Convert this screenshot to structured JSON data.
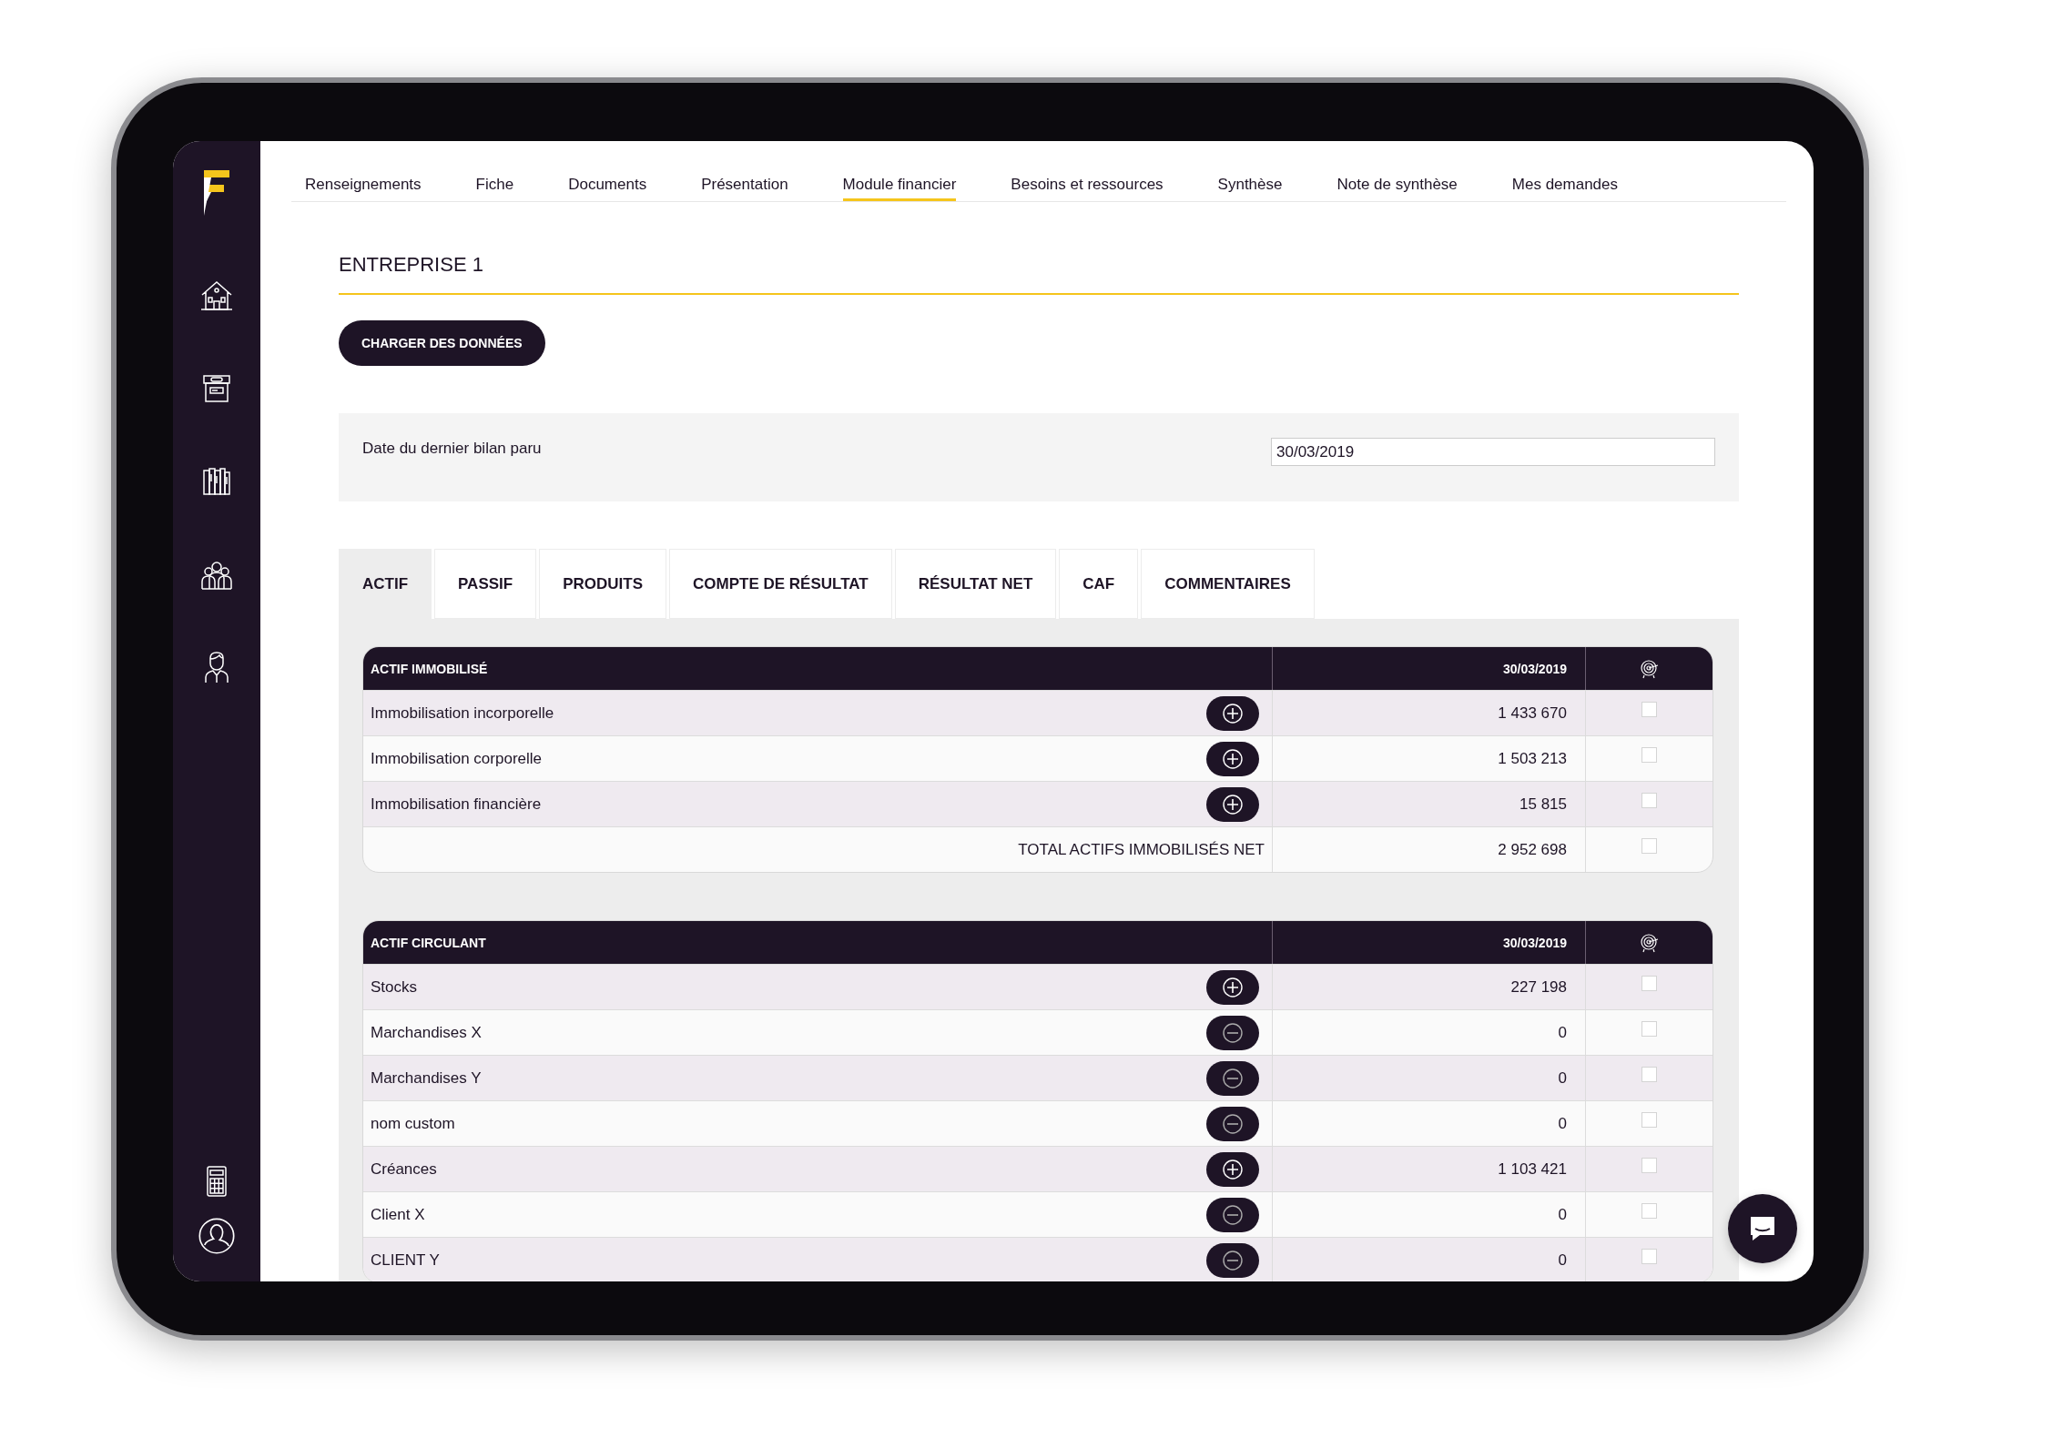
{
  "nav": {
    "items": [
      {
        "label": "Renseignements",
        "selected": false
      },
      {
        "label": "Fiche",
        "selected": false
      },
      {
        "label": "Documents",
        "selected": false
      },
      {
        "label": "Présentation",
        "selected": false
      },
      {
        "label": "Module financier",
        "selected": true
      },
      {
        "label": "Besoins et ressources",
        "selected": false
      },
      {
        "label": "Synthèse",
        "selected": false
      },
      {
        "label": "Note de synthèse",
        "selected": false
      },
      {
        "label": "Mes demandes",
        "selected": false
      }
    ]
  },
  "title": "ENTREPRISE 1",
  "load_button": "CHARGER DES DONNÉES",
  "date_field": {
    "label": "Date du dernier bilan paru",
    "value": "30/03/2019"
  },
  "tabs": [
    {
      "label": "ACTIF",
      "selected": true
    },
    {
      "label": "PASSIF",
      "selected": false
    },
    {
      "label": "PRODUITS",
      "selected": false
    },
    {
      "label": "COMPTE DE RÉSULTAT",
      "selected": false
    },
    {
      "label": "RÉSULTAT NET",
      "selected": false
    },
    {
      "label": "CAF",
      "selected": false
    },
    {
      "label": "COMMENTAIRES",
      "selected": false
    }
  ],
  "tables": [
    {
      "title": "ACTIF IMMOBILISÉ",
      "date": "30/03/2019",
      "rows": [
        {
          "kind": "expand",
          "label": "Immobilisation incorporelle",
          "value": "1 433 670",
          "checked": false
        },
        {
          "kind": "expand",
          "label": "Immobilisation corporelle",
          "value": "1 503 213",
          "checked": false
        },
        {
          "kind": "expand",
          "label": "Immobilisation financière",
          "value": "15 815",
          "checked": false
        },
        {
          "kind": "total",
          "label": "TOTAL ACTIFS IMMOBILISÉS NET",
          "value": "2 952 698",
          "checked": false
        }
      ]
    },
    {
      "title": "ACTIF CIRCULANT",
      "date": "30/03/2019",
      "rows": [
        {
          "kind": "expand",
          "label": "Stocks",
          "value": "227 198",
          "checked": false
        },
        {
          "kind": "collapse",
          "label": "Marchandises X",
          "value": "0",
          "checked": false
        },
        {
          "kind": "collapse",
          "label": "Marchandises Y",
          "value": "0",
          "checked": false
        },
        {
          "kind": "collapse",
          "label": "nom custom",
          "value": "0",
          "checked": false
        },
        {
          "kind": "expand",
          "label": "Créances",
          "value": "1 103 421",
          "checked": false
        },
        {
          "kind": "collapse",
          "label": "Client X",
          "value": "0",
          "checked": false
        },
        {
          "kind": "collapse",
          "label": "CLIENT Y",
          "value": "0",
          "checked": false
        }
      ]
    }
  ]
}
